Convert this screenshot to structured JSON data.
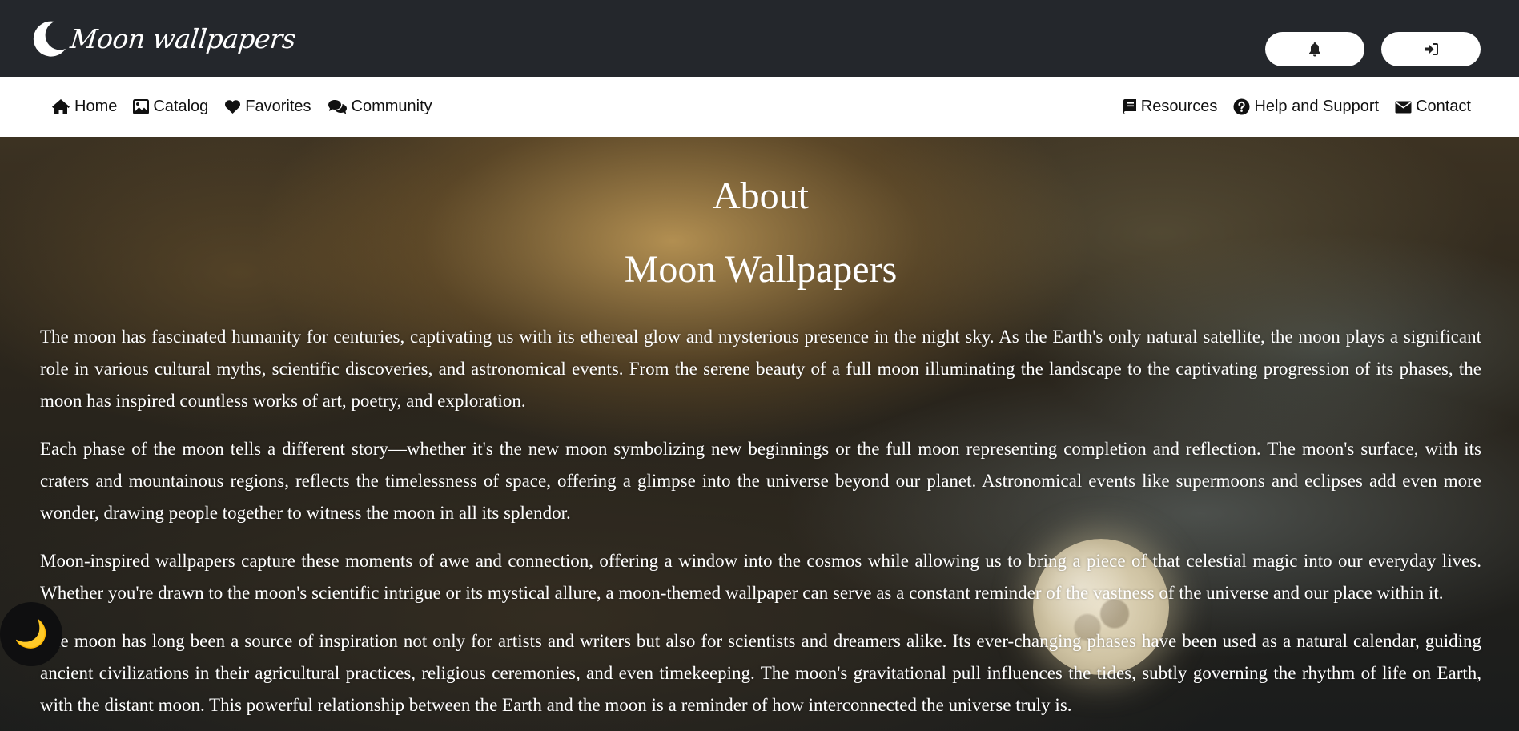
{
  "header": {
    "brand_name": "Moon wallpapers",
    "brand_icon": "crescent-moon-icon",
    "notifications_icon": "bell-icon",
    "login_icon": "sign-in-icon"
  },
  "nav": {
    "left": [
      {
        "label": "Home",
        "icon": "home-icon"
      },
      {
        "label": "Catalog",
        "icon": "image-icon"
      },
      {
        "label": "Favorites",
        "icon": "heart-icon"
      },
      {
        "label": "Community",
        "icon": "comments-icon"
      }
    ],
    "right": [
      {
        "label": "Resources",
        "icon": "book-icon"
      },
      {
        "label": "Help and Support",
        "icon": "question-circle-icon"
      },
      {
        "label": "Contact",
        "icon": "envelope-icon"
      }
    ]
  },
  "main": {
    "title": "About",
    "subtitle": "Moon Wallpapers",
    "paragraphs": [
      "The moon has fascinated humanity for centuries, captivating us with its ethereal glow and mysterious presence in the night sky. As the Earth's only natural satellite, the moon plays a significant role in various cultural myths, scientific discoveries, and astronomical events. From the serene beauty of a full moon illuminating the landscape to the captivating progression of its phases, the moon has inspired countless works of art, poetry, and exploration.",
      "Each phase of the moon tells a different story—whether it's the new moon symbolizing new beginnings or the full moon representing completion and reflection. The moon's surface, with its craters and mountainous regions, reflects the timelessness of space, offering a glimpse into the universe beyond our planet. Astronomical events like supermoons and eclipses add even more wonder, drawing people together to witness the moon in all its splendor.",
      "Moon-inspired wallpapers capture these moments of awe and connection, offering a window into the cosmos while allowing us to bring a piece of that celestial magic into our everyday lives. Whether you're drawn to the moon's scientific intrigue or its mystical allure, a moon-themed wallpaper can serve as a constant reminder of the vastness of the universe and our place within it.",
      "The moon has long been a source of inspiration not only for artists and writers but also for scientists and dreamers alike. Its ever-changing phases have been used as a natural calendar, guiding ancient civilizations in their agricultural practices, religious ceremonies, and even timekeeping. The moon's gravitational pull influences the tides, subtly governing the rhythm of life on Earth, with the distant moon. This powerful relationship between the Earth and the moon is a reminder of how interconnected the universe truly is."
    ]
  },
  "theme_toggle": {
    "glyph": "🌙",
    "icon": "crescent-moon-icon"
  },
  "colors": {
    "header_bg": "#24272c",
    "nav_bg": "#ffffff",
    "text_light": "#ffffff"
  }
}
